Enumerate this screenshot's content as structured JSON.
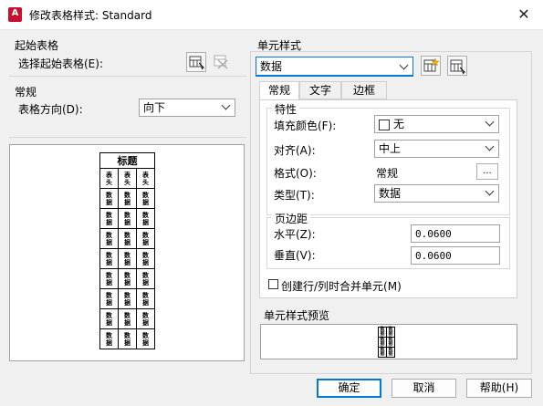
{
  "window": {
    "title": "修改表格样式: Standard",
    "app_icon": "A"
  },
  "start_table": {
    "section": "起始表格",
    "label": "选择起始表格(E):",
    "select_icon": "table-select-icon",
    "remove_icon": "table-remove-icon"
  },
  "general": {
    "section": "常规",
    "direction_label": "表格方向(D):",
    "direction_value": "向下"
  },
  "preview": {
    "title": "标题",
    "header": "表头",
    "data": "数据",
    "data_rows": 8,
    "columns": 3
  },
  "cell_style": {
    "section": "单元样式",
    "selected": "数据",
    "new_icon": "new-cell-style-icon",
    "manage_icon": "manage-cell-styles-icon",
    "tabs": [
      "常规",
      "文字",
      "边框"
    ],
    "active_tab": "常规",
    "properties": {
      "section": "特性",
      "fill_label": "填充颜色(F):",
      "fill_value": "无",
      "align_label": "对齐(A):",
      "align_value": "中上",
      "format_label": "格式(O):",
      "format_value": "常规",
      "format_button": "...",
      "type_label": "类型(T):",
      "type_value": "数据"
    },
    "margins": {
      "section": "页边距",
      "horizontal_label": "水平(Z):",
      "horizontal_value": "0.0600",
      "vertical_label": "垂直(V):",
      "vertical_value": "0.0600"
    },
    "merge_label": "创建行/列时合并单元(M)",
    "merge_checked": false,
    "preview_section": "单元样式预览"
  },
  "buttons": {
    "ok": "确定",
    "cancel": "取消",
    "help": "帮助(H)"
  }
}
